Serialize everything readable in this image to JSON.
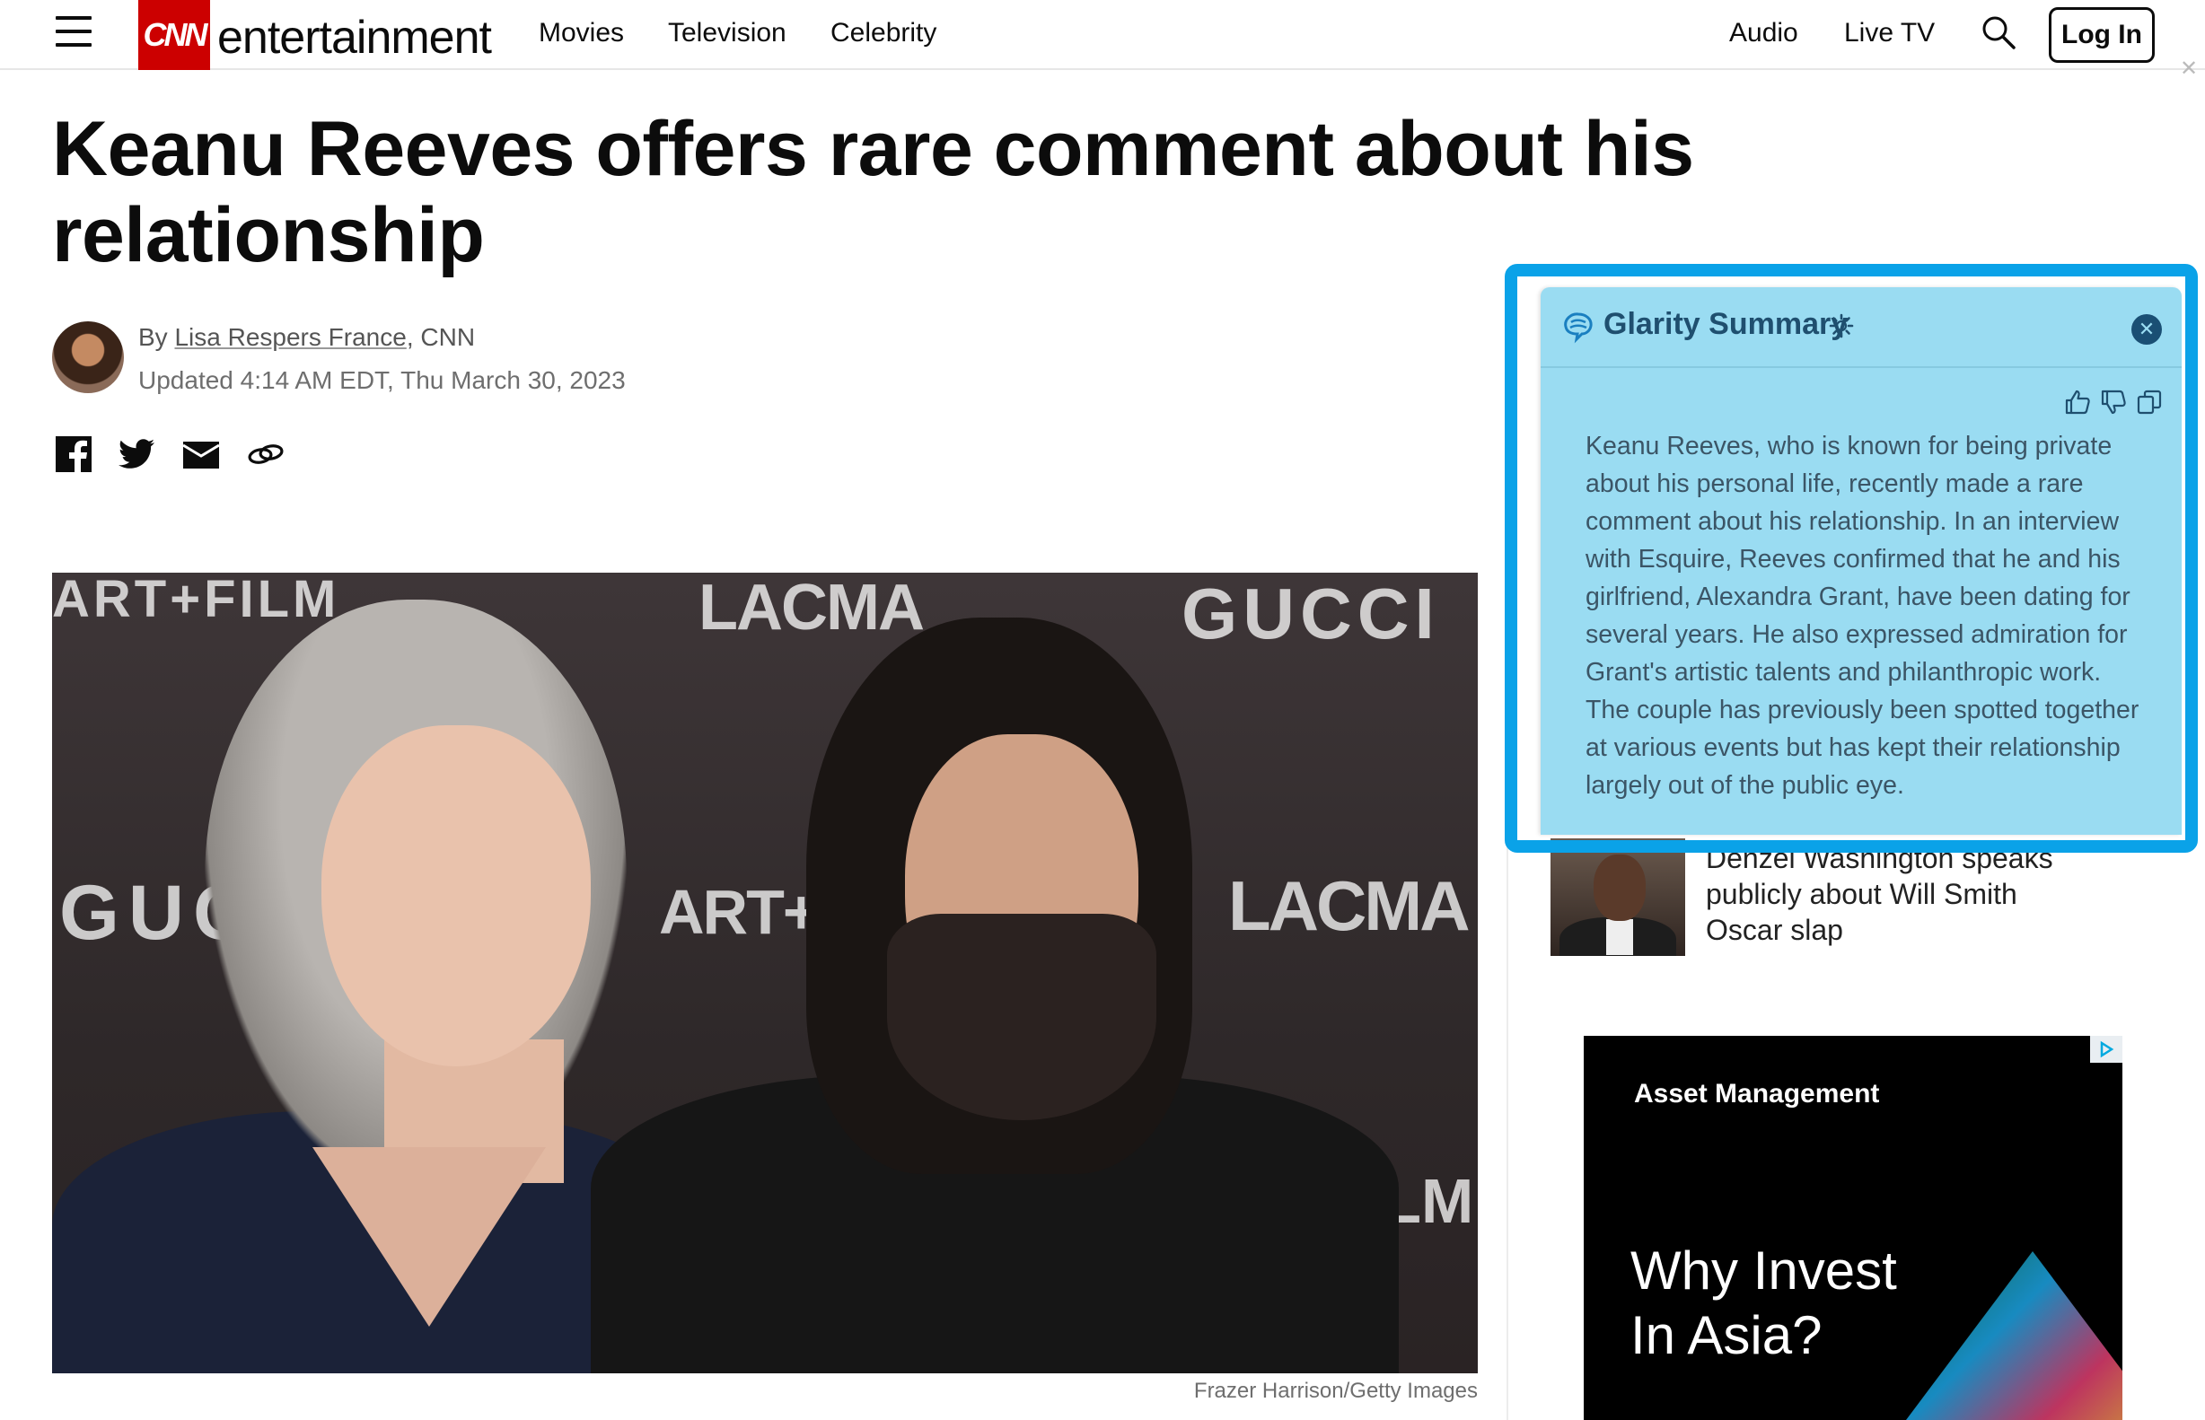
{
  "header": {
    "brand": "CNN",
    "section": "entertainment",
    "nav": [
      "Movies",
      "Television",
      "Celebrity"
    ],
    "right_links": [
      "Audio",
      "Live TV"
    ],
    "login_label": "Log In",
    "corner_close": "✕"
  },
  "article": {
    "headline": "Keanu Reeves offers rare comment about his relationship",
    "by_prefix": "By ",
    "author": "Lisa Respers France",
    "outlet": ", CNN",
    "updated": "Updated 4:14 AM EDT, Thu March 30, 2023",
    "photo_caption": "Frazer Harrison/Getty Images",
    "photo_signage": [
      "ART+FILM",
      "LACMA",
      "GUCCI",
      "GUCCI",
      "ART+",
      "LACMA",
      "FILM"
    ]
  },
  "sidebar": {
    "related": {
      "title": "Denzel Washington speaks publicly about Will Smith Oscar slap"
    },
    "ad": {
      "label": "Asset Management",
      "headline": "Why Invest In Asia?"
    }
  },
  "glarity": {
    "title": "Glarity Summary",
    "close": "✕",
    "summary": "Keanu Reeves, who is known for being private about his personal life, recently made a rare comment about his relationship. In an interview with Esquire, Reeves confirmed that he and his girlfriend, Alexandra Grant, have been dating for several years. He also expressed admiration for Grant's artistic talents and philanthropic work. The couple has previously been spotted together at various events but has kept their relationship largely out of the public eye."
  },
  "colors": {
    "cnn_red": "#cc0000",
    "glarity_border": "#0aa2e8",
    "glarity_panel": "#9adcf2"
  }
}
